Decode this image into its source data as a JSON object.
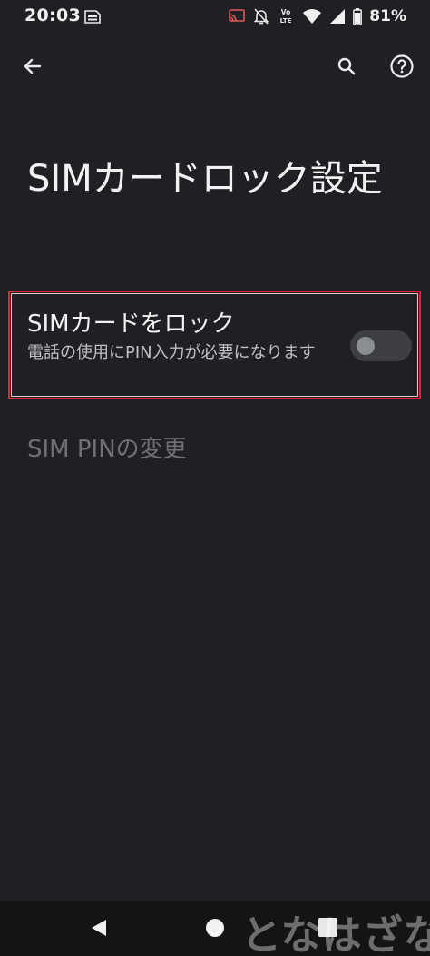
{
  "status_bar": {
    "time": "20:03",
    "battery_percent": "81%",
    "icons": [
      "sim-card-icon",
      "cast-icon",
      "notifications-off-icon",
      "volte-icon",
      "wifi-icon",
      "signal-icon",
      "battery-icon"
    ],
    "volte_text": [
      "Vo",
      "LTE"
    ]
  },
  "toolbar": {
    "icons": [
      "back-arrow-icon",
      "search-icon",
      "help-icon"
    ]
  },
  "page": {
    "title": "SIMカードロック設定"
  },
  "settings": {
    "lock_sim": {
      "title": "SIMカードをロック",
      "summary": "電話の使用にPIN入力が必要になります",
      "enabled": false
    },
    "change_pin": {
      "title": "SIM PINの変更",
      "disabled": true
    }
  },
  "colors": {
    "background": "#1f2023",
    "highlight_border": "#d9253a",
    "toggle_track": "#3d3f43",
    "toggle_thumb": "#8b8e93",
    "disabled_text": "#6f7175"
  },
  "nav_bar": {
    "icons": [
      "nav-back-icon",
      "nav-home-icon",
      "nav-recents-icon"
    ]
  },
  "watermark": "となはざな"
}
